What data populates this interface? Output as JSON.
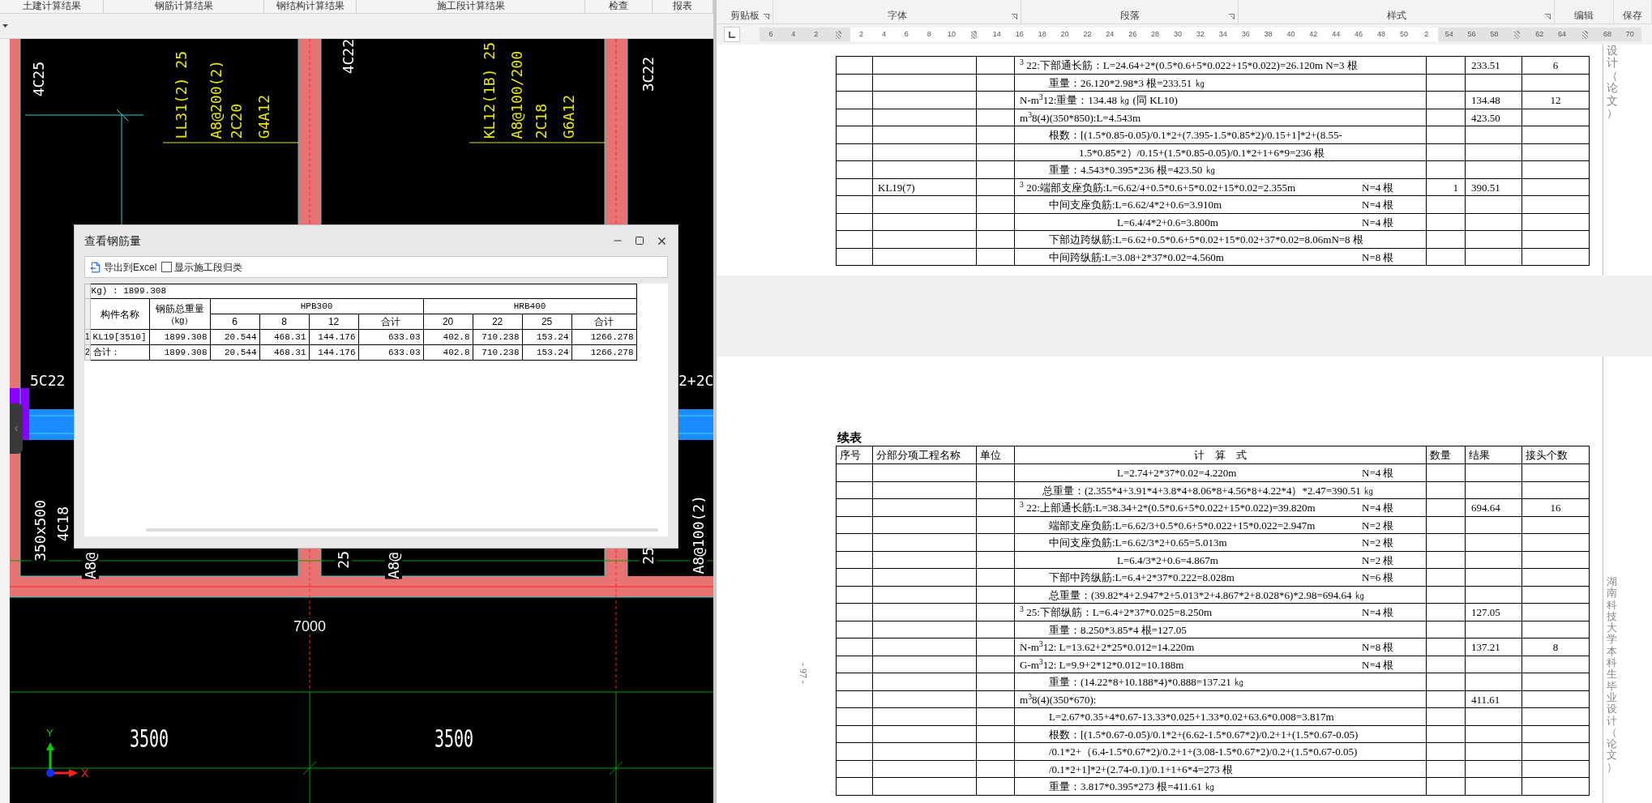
{
  "cad_app": {
    "tabs": [
      "土建计算结果",
      "钢筋计算结果",
      "钢结构计算结果",
      "施工段计算结果",
      "检查",
      "报表"
    ],
    "labels": [
      {
        "text": "4C25",
        "kind": "vertical",
        "color": "#ffffff"
      },
      {
        "text": "LL31(2) 25",
        "kind": "vertical",
        "color": "#e8e800"
      },
      {
        "text": "A8@200(2)",
        "kind": "vertical",
        "color": "#e8e800"
      },
      {
        "text": "2C20",
        "kind": "vertical",
        "color": "#e8e800"
      },
      {
        "text": "G4A12",
        "kind": "vertical",
        "color": "#e8e800"
      },
      {
        "text": "4C22",
        "kind": "vertical",
        "color": "#ffffff"
      },
      {
        "text": "KL12(1B) 25",
        "kind": "vertical",
        "color": "#e8e800"
      },
      {
        "text": "A8@100/200",
        "kind": "vertical",
        "color": "#e8e800"
      },
      {
        "text": "2C18",
        "kind": "vertical",
        "color": "#e8e800"
      },
      {
        "text": "G6A12",
        "kind": "vertical",
        "color": "#e8e800"
      },
      {
        "text": "3C22",
        "kind": "vertical",
        "color": "#ffffff"
      },
      {
        "text": "5C22",
        "kind": "horizontal",
        "color": "#ffffff"
      },
      {
        "text": "2+2C",
        "kind": "horizontal",
        "color": "#ffffff"
      },
      {
        "text": "350x500",
        "kind": "vertical",
        "color": "#ffffff"
      },
      {
        "text": "4C18",
        "kind": "vertical",
        "color": "#ffffff"
      },
      {
        "text": "A8@",
        "kind": "vertical",
        "color": "#ffffff"
      },
      {
        "text": "25",
        "kind": "vertical",
        "color": "#ffffff"
      },
      {
        "text": "A8@",
        "kind": "vertical",
        "color": "#ffffff"
      },
      {
        "text": "25",
        "kind": "vertical",
        "color": "#ffffff"
      },
      {
        "text": "A8@100(2)",
        "kind": "vertical",
        "color": "#ffffff"
      },
      {
        "text": "7000",
        "kind": "span",
        "color": "#ffffff"
      },
      {
        "text": "3500",
        "kind": "dimension",
        "color": "#ffffff"
      },
      {
        "text": "3500",
        "kind": "dimension",
        "color": "#ffffff"
      }
    ],
    "axis": {
      "y_label": "Y",
      "x_label": "X"
    },
    "dialog": {
      "title": "查看钢筋量",
      "export_label": "导出到Excel",
      "checkbox": {
        "label": "显示施工段归类",
        "checked": false
      },
      "table": {
        "summary": "Kg) : 1899.308",
        "name_header": "构件名称",
        "weight_header": "钢筋总重量",
        "weight_unit": "（kg）",
        "groups": [
          {
            "name": "HPB300",
            "columns": [
              "6",
              "8",
              "12",
              "合计"
            ]
          },
          {
            "name": "HRB400",
            "columns": [
              "20",
              "22",
              "25",
              "合计"
            ]
          }
        ],
        "rows": [
          {
            "number": "1",
            "name": "KL19[3510]",
            "total": "1899.308",
            "values": [
              "20.544",
              "468.31",
              "144.176",
              "633.03",
              "402.8",
              "710.238",
              "153.24",
              "1266.278"
            ]
          },
          {
            "number": "2",
            "name": "合计：",
            "total": "1899.308",
            "values": [
              "20.544",
              "468.31",
              "144.176",
              "633.03",
              "402.8",
              "710.238",
              "153.24",
              "1266.278"
            ]
          }
        ]
      }
    }
  },
  "word": {
    "ribbon_groups": [
      "剪贴板",
      "字体",
      "段落",
      "样式",
      "编辑",
      "保存"
    ],
    "ruler": [
      {
        "kind": "number",
        "label": "6"
      },
      {
        "kind": "number",
        "label": "4"
      },
      {
        "kind": "number",
        "label": "2"
      },
      {
        "kind": "marker"
      },
      {
        "kind": "number",
        "label": "2"
      },
      {
        "kind": "number",
        "label": "4"
      },
      {
        "kind": "number",
        "label": "6"
      },
      {
        "kind": "number",
        "label": "8"
      },
      {
        "kind": "number",
        "label": "10"
      },
      {
        "kind": "marker"
      },
      {
        "kind": "number",
        "label": "14"
      },
      {
        "kind": "number",
        "label": "16"
      },
      {
        "kind": "number",
        "label": "18"
      },
      {
        "kind": "number",
        "label": "20"
      },
      {
        "kind": "number",
        "label": "22"
      },
      {
        "kind": "number",
        "label": "24"
      },
      {
        "kind": "number",
        "label": "26"
      },
      {
        "kind": "number",
        "label": "28"
      },
      {
        "kind": "number",
        "label": "30"
      },
      {
        "kind": "number",
        "label": "32"
      },
      {
        "kind": "number",
        "label": "34"
      },
      {
        "kind": "number",
        "label": "36"
      },
      {
        "kind": "number",
        "label": "38"
      },
      {
        "kind": "number",
        "label": "40"
      },
      {
        "kind": "number",
        "label": "42"
      },
      {
        "kind": "number",
        "label": "44"
      },
      {
        "kind": "number",
        "label": "46"
      },
      {
        "kind": "number",
        "label": "48"
      },
      {
        "kind": "number",
        "label": "50"
      },
      {
        "kind": "number",
        "label": "2"
      },
      {
        "kind": "number",
        "label": "54"
      },
      {
        "kind": "number",
        "label": "56"
      },
      {
        "kind": "number",
        "label": "58"
      },
      {
        "kind": "marker"
      },
      {
        "kind": "number",
        "label": "62"
      },
      {
        "kind": "number",
        "label": "64"
      },
      {
        "kind": "marker"
      },
      {
        "kind": "number",
        "label": "68"
      },
      {
        "kind": "number",
        "label": "70"
      }
    ],
    "page1": {
      "side_text": "设计（论文）",
      "rows": [
        {
          "kind": "head",
          "formula": "$^{3}$ 22:下部通长筋：L=24.64+2*(0.5*0.6+5*0.022+15*0.022)=26.120m N=3 根",
          "result": "233.51",
          "joints": "6"
        },
        {
          "kind": "sub",
          "formula": "重量：26.120*2.98*3 根=233.51 ㎏"
        },
        {
          "kind": "left",
          "formula": "N-m$^{3}$12:重量：134.48 ㎏ (同 KL10)",
          "result": "134.48",
          "joints": "12"
        },
        {
          "kind": "left",
          "formula": "m$^{3}$8(4)(350*850):L=4.543m",
          "result": "423.50"
        },
        {
          "kind": "sub",
          "formula": "根数：[(1.5*0.85-0.05)/0.1*2+(7.395-1.5*0.85*2)/0.15+1]*2+(8.55-"
        },
        {
          "kind": "wrap",
          "formula": "1.5*0.85*2）/0.15+(1.5*0.85-0.05)/0.1*2+1+6*9=236 根"
        },
        {
          "kind": "sub",
          "formula": "重量：4.543*0.395*236 根=423.50 ㎏"
        },
        {
          "kind": "head",
          "name": "KL19(7)",
          "formula": "$^{3}$ 20:端部支座负筋:L=6.62/4+0.5*0.6+5*0.02+15*0.02=2.355m",
          "count": "N=4 根",
          "quantity": "1",
          "result": "390.51"
        },
        {
          "kind": "sub",
          "formula": "中间支座负筋:L=6.62/4*2+0.6=3.910m",
          "count": "N=4 根"
        },
        {
          "kind": "deep",
          "formula": "L=6.4/4*2+0.6=3.800m",
          "count": "N=4 根"
        },
        {
          "kind": "sub",
          "formula": "下部边跨纵筋:L=6.62+0.5*0.6+5*0.02+15*0.02+37*0.02=8.06mN=8 根"
        },
        {
          "kind": "sub",
          "formula": "中间跨纵筋:L=3.08+2*37*0.02=4.560m",
          "count": "N=8 根"
        }
      ]
    },
    "page2": {
      "continued_label": "续表",
      "page_number": "- 97 -",
      "side_text": "湖南科技大学本科生毕业设计（论文）",
      "header": [
        "序号",
        "分部分项工程名称",
        "单位",
        "计　算　式",
        "数量",
        "结果",
        "接头个数"
      ],
      "rows": [
        {
          "kind": "deep",
          "formula": "L=2.74+2*37*0.02=4.220m",
          "count": "N=4 根"
        },
        {
          "kind": "total",
          "formula": "总重量：(2.355*4+3.91*4+3.8*4+8.06*8+4.56*8+4.22*4）*2.47=390.51 ㎏"
        },
        {
          "kind": "head",
          "formula": "$^{3}$ 22:上部通长筋:L=38.34+2*(0.5*0.6+5*0.022+15*0.022)=39.820m",
          "count": "N=4 根",
          "result": "694.64",
          "joints": "16"
        },
        {
          "kind": "sub",
          "formula": "端部支座负筋:L=6.62/3+0.5*0.6+5*0.022+15*0.022=2.947m",
          "count": "N=2 根"
        },
        {
          "kind": "sub",
          "formula": "中间支座负筋:L=6.62/3*2+0.65=5.013m",
          "count": "N=2 根"
        },
        {
          "kind": "deep",
          "formula": "L=6.4/3*2+0.6=4.867m",
          "count": "N=2 根"
        },
        {
          "kind": "sub",
          "formula": "下部中跨纵筋:L=6.4+2*37*0.222=8.028m",
          "count": "N=6 根"
        },
        {
          "kind": "sub",
          "formula": "总重量：(39.82*4+2.947*2+5.013*2+4.867*2+8.028*6)*2.98=694.64 ㎏"
        },
        {
          "kind": "head",
          "formula": "$^{3}$ 25:下部纵筋：L=6.4+2*37*0.025=8.250m",
          "count": "N=4 根",
          "result": "127.05"
        },
        {
          "kind": "sub",
          "formula": "重量：8.250*3.85*4 根=127.05"
        },
        {
          "kind": "left",
          "formula": "N-m$^{3}$12: L=13.62+2*25*0.012=14.220m",
          "count": "N=8 根",
          "result": "137.21",
          "joints": "8"
        },
        {
          "kind": "left",
          "formula": "G-m$^{3}$12: L=9.9+2*12*0.012=10.188m",
          "count": "N=4 根"
        },
        {
          "kind": "sub",
          "formula": "重量：(14.22*8+10.188*4)*0.888=137.21 ㎏"
        },
        {
          "kind": "left",
          "formula": "m$^{3}$8(4)(350*670):",
          "result": "411.61"
        },
        {
          "kind": "sub",
          "formula": "L=2.67*0.35+4*0.67-13.33*0.025+1.33*0.02+63.6*0.008=3.817m"
        },
        {
          "kind": "sub",
          "formula": "根数：[(1.5*0.67-0.05)/0.1*2+(6.62-1.5*0.67*2)/0.2+1+(1.5*0.67-0.05)"
        },
        {
          "kind": "sub",
          "formula": "/0.1*2+（6.4-1.5*0.67*2)/0.2+1+(3.08-1.5*0.67*2)/0.2+(1.5*0.67-0.05)"
        },
        {
          "kind": "sub",
          "formula": "/0.1*2+1]*2+(2.74-0.1)/0.1+1+6*4=273  根"
        },
        {
          "kind": "sub",
          "formula": "重量：3.817*0.395*273 根=411.61 ㎏"
        }
      ]
    }
  }
}
